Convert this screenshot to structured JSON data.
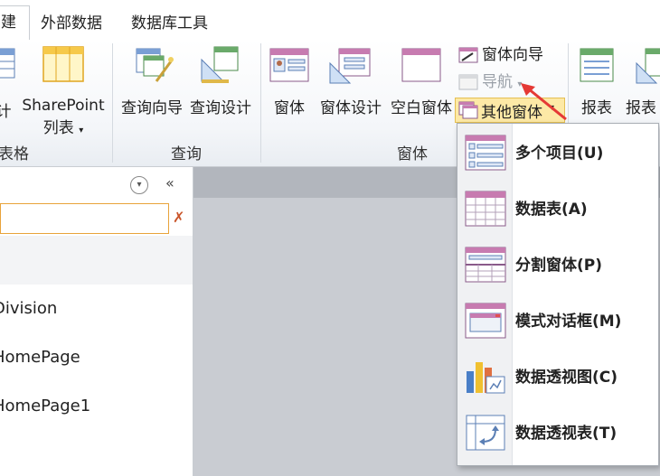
{
  "tabs": [
    {
      "label": "建",
      "active": true
    },
    {
      "label": "外部数据",
      "active": false
    },
    {
      "label": "数据库工具",
      "active": false
    }
  ],
  "ribbon": {
    "groups": {
      "tables": "表格",
      "queries": "查询",
      "forms": "窗体"
    },
    "buttons": {
      "design": "计",
      "sharepoint_line1": "SharePoint",
      "sharepoint_line2": "列表",
      "query_wizard": "查询向导",
      "query_design": "查询设计",
      "form": "窗体",
      "form_design": "窗体设计",
      "blank_form": "空白窗体",
      "form_wizard": "窗体向导",
      "navigation": "导航",
      "more_forms": "其他窗体",
      "report": "报表",
      "report_design": "报表"
    }
  },
  "navpane": {
    "items": [
      "Division",
      "HomePage",
      "HomePage1"
    ]
  },
  "dropdown": {
    "items": [
      {
        "label": "多个项目(U)",
        "icon": "multiple-items-icon"
      },
      {
        "label": "数据表(A)",
        "icon": "datasheet-icon"
      },
      {
        "label": "分割窗体(P)",
        "icon": "split-form-icon"
      },
      {
        "label": "模式对话框(M)",
        "icon": "modal-dialog-icon"
      },
      {
        "label": "数据透视图(C)",
        "icon": "pivot-chart-icon"
      },
      {
        "label": "数据透视表(T)",
        "icon": "pivot-table-icon"
      }
    ]
  },
  "colors": {
    "highlight": "#fde9a6",
    "arrow": "#e53935",
    "accent_orange": "#e8a33a"
  }
}
